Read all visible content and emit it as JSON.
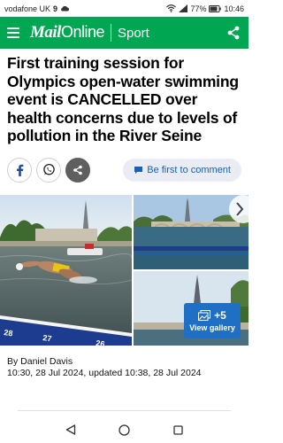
{
  "status_bar": {
    "carrier": "vodafone UK",
    "network_badge": "9",
    "battery": "77%",
    "time": "10:46"
  },
  "header": {
    "logo_mail": "Mail",
    "logo_online": "Online",
    "section": "Sport"
  },
  "article": {
    "headline": "First training session for Olympics open-water swimming event is CANCELLED over health concerns due to levels of pollution in the River Seine",
    "comment_cta": "Be first to comment",
    "byline": "By Daniel Davis",
    "timestamp": "10:30, 28 Jul 2024, updated 10:38, 28 Jul 2024"
  },
  "gallery": {
    "extra_count": "+5",
    "view_label": "View gallery",
    "lane_numbers": [
      "28",
      "27",
      "26"
    ]
  },
  "colors": {
    "brand_green": "#00a651",
    "gallery_blue": "#1f6fc4",
    "link_blue": "#1a5fb4"
  },
  "icons": {
    "share": "share-icon",
    "facebook": "facebook-icon",
    "whatsapp": "whatsapp-icon",
    "more_share": "share-icon",
    "comment": "comment-icon",
    "gallery": "gallery-icon",
    "next": "chevron-right-icon"
  }
}
